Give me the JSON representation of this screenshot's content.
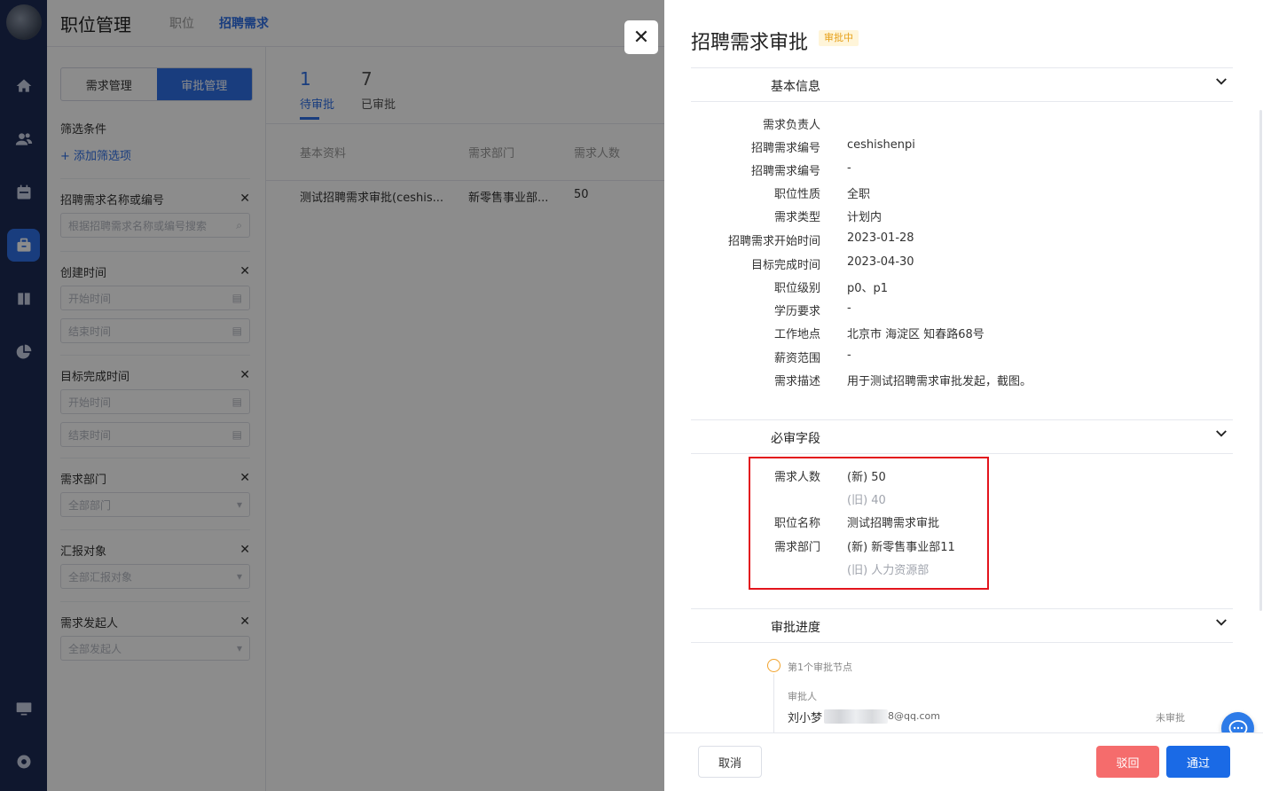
{
  "header": {
    "title": "职位管理",
    "breadcrumb": [
      "职位",
      "招聘需求"
    ]
  },
  "filter_panel": {
    "segments": [
      "需求管理",
      "审批管理"
    ],
    "heading": "筛选条件",
    "add_label": "+ 添加筛选项",
    "groups": [
      {
        "label": "招聘需求名称或编号",
        "inputs": [
          "根据招聘需求名称或编号搜索"
        ]
      },
      {
        "label": "创建时间",
        "inputs": [
          "开始时间",
          "结束时间"
        ]
      },
      {
        "label": "目标完成时间",
        "inputs": [
          "开始时间",
          "结束时间"
        ]
      },
      {
        "label": "需求部门",
        "inputs": [
          "全部部门"
        ]
      },
      {
        "label": "汇报对象",
        "inputs": [
          "全部汇报对象"
        ]
      },
      {
        "label": "需求发起人",
        "inputs": [
          "全部发起人"
        ]
      }
    ]
  },
  "list": {
    "tabs": [
      {
        "count": "1",
        "label": "待审批"
      },
      {
        "count": "7",
        "label": "已审批"
      }
    ],
    "columns": [
      "基本资料",
      "需求部门",
      "需求人数"
    ],
    "rows": [
      [
        "测试招聘需求审批(ceshis...",
        "新零售事业部...",
        "50"
      ]
    ]
  },
  "drawer": {
    "title": "招聘需求审批",
    "badge": "审批中",
    "sections": {
      "basic": "基本信息",
      "required": "必审字段",
      "progress": "审批进度"
    },
    "basic_info": [
      {
        "k": "需求负责人",
        "v": ""
      },
      {
        "k": "招聘需求编号",
        "v": "ceshishenpi"
      },
      {
        "k": "招聘需求编号",
        "v": "-"
      },
      {
        "k": "职位性质",
        "v": "全职"
      },
      {
        "k": "需求类型",
        "v": "计划内"
      },
      {
        "k": "招聘需求开始时间",
        "v": "2023-01-28"
      },
      {
        "k": "目标完成时间",
        "v": "2023-04-30"
      },
      {
        "k": "职位级别",
        "v": "p0、p1"
      },
      {
        "k": "学历要求",
        "v": "-"
      },
      {
        "k": "工作地点",
        "v": "北京市 海淀区 知春路68号"
      },
      {
        "k": "薪资范围",
        "v": "-"
      },
      {
        "k": "需求描述",
        "v": "用于测试招聘需求审批发起，截图。"
      }
    ],
    "required_fields": [
      {
        "k": "需求人数",
        "v": "(新) 50",
        "old": false
      },
      {
        "k": "",
        "v": "(旧) 40",
        "old": true
      },
      {
        "k": "职位名称",
        "v": "测试招聘需求审批",
        "old": false
      },
      {
        "k": "需求部门",
        "v": "(新) 新零售事业部11",
        "old": false
      },
      {
        "k": "",
        "v": "(旧) 人力资源部",
        "old": true
      }
    ],
    "progress": {
      "node": "第1个审批节点",
      "approver_label": "审批人",
      "approver_name": "刘小梦",
      "approver_email": "8@qq.com",
      "status": "未审批"
    },
    "footer": {
      "cancel": "取消",
      "reject": "驳回",
      "pass": "通过"
    }
  }
}
